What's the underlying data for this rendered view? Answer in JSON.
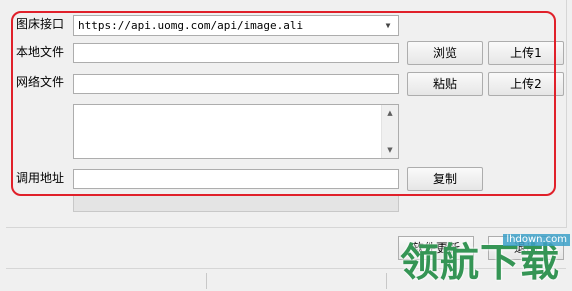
{
  "form": {
    "api_label": "图床接口",
    "api_value": "https://api.uomg.com/api/image.ali",
    "local_file_label": "本地文件",
    "local_file_value": "",
    "net_file_label": "网络文件",
    "net_file_value": "",
    "call_url_label": "调用地址",
    "call_url_value": "",
    "textarea_value": ""
  },
  "buttons": {
    "browse": "浏览",
    "upload1": "上传1",
    "paste": "粘贴",
    "upload2": "上传2",
    "copy": "复制"
  },
  "bottom": {
    "update_button": "软件更新",
    "exit_button": "退出"
  },
  "watermark": {
    "brand": "领航下载",
    "url": "lhdown.com"
  },
  "icons": {
    "combo_arrow": "chevron-down-icon",
    "scroll_up": "scroll-up-icon",
    "scroll_down": "scroll-down-icon"
  },
  "colors": {
    "highlight": "#e0202a",
    "watermark": "#248c46"
  }
}
